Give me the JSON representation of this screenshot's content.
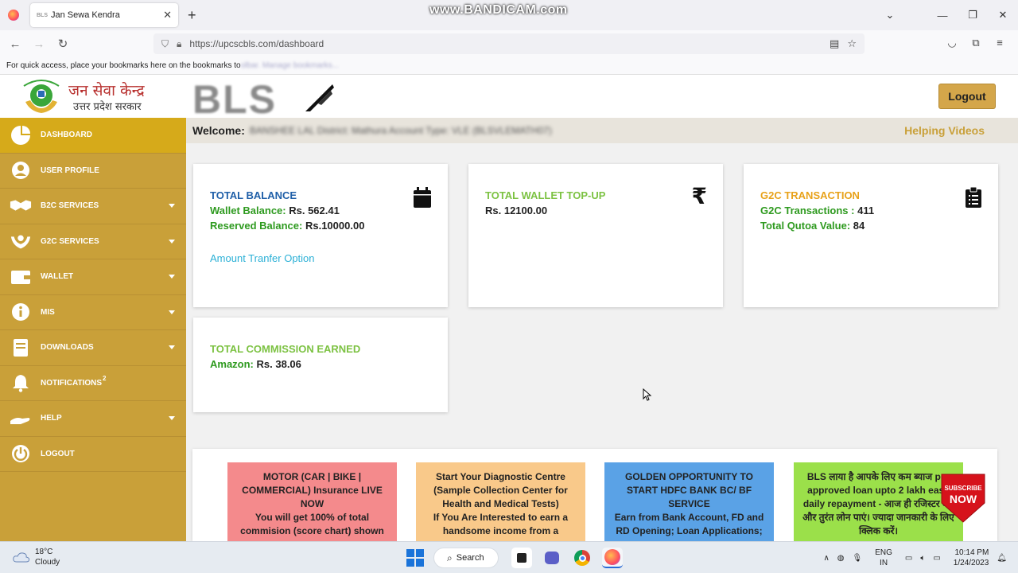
{
  "browser": {
    "tab_title": "Jan Sewa Kendra",
    "tab_favicon_text": "BLS",
    "url": "https://upcscbls.com/dashboard",
    "bookmarks_hint": "For quick access, place your bookmarks here on the bookmarks to",
    "bookmarks_hint_blurred": "olbar. Manage bookmarks...",
    "watermark": "www.BANDICAM.com"
  },
  "header": {
    "jsk_line1": "जन सेवा केन्द्र",
    "jsk_line2": "उत्तर प्रदेश सरकार",
    "bls_logo": "BLS",
    "logout_label": "Logout"
  },
  "sidebar": {
    "items": [
      {
        "label": "DASHBOARD",
        "icon": "pie-chart-icon",
        "active": true,
        "dropdown": false
      },
      {
        "label": "USER PROFILE",
        "icon": "user-icon",
        "active": false,
        "dropdown": false
      },
      {
        "label": "B2C SERVICES",
        "icon": "handshake-icon",
        "active": false,
        "dropdown": true
      },
      {
        "label": "G2C SERVICES",
        "icon": "hands-icon",
        "active": false,
        "dropdown": true
      },
      {
        "label": "WALLET",
        "icon": "wallet-icon",
        "active": false,
        "dropdown": true
      },
      {
        "label": "MIS",
        "icon": "info-icon",
        "active": false,
        "dropdown": true
      },
      {
        "label": "DOWNLOADS",
        "icon": "book-icon",
        "active": false,
        "dropdown": true
      },
      {
        "label": "NOTIFICATIONS",
        "icon": "bell-icon",
        "active": false,
        "dropdown": false,
        "badge": "2"
      },
      {
        "label": "HELP",
        "icon": "help-hand-icon",
        "active": false,
        "dropdown": true
      },
      {
        "label": "LOGOUT",
        "icon": "power-icon",
        "active": false,
        "dropdown": false
      }
    ]
  },
  "welcome": {
    "label": "Welcome:",
    "blurred_info": "BANSHEE LAL    District: Mathura    Account Type: VLE (BLSVLEMATH07)",
    "helping_videos": "Helping Videos"
  },
  "cards": {
    "balance": {
      "title": "TOTAL BALANCE",
      "wallet_label": "Wallet Balance:",
      "wallet_value": "Rs. 562.41",
      "reserved_label": "Reserved Balance:",
      "reserved_value": "Rs.10000.00",
      "link": "Amount Tranfer Option",
      "title_color": "#1f5fa8",
      "icon": "calendar-icon"
    },
    "topup": {
      "title": "TOTAL WALLET TOP-UP",
      "value": "Rs. 12100.00",
      "title_color": "#7cc242",
      "icon": "rupee-icon"
    },
    "g2c": {
      "title": "G2C TRANSACTION",
      "tx_label": "G2C Transactions :",
      "tx_value": "411",
      "quota_label": "Total Qutoa Value:",
      "quota_value": "84",
      "title_color": "#e8a21a",
      "icon": "clipboard-icon"
    },
    "commission": {
      "title": "TOTAL COMMISSION EARNED",
      "amazon_label": "Amazon:",
      "amazon_value": "Rs. 38.06",
      "title_color": "#7cc242"
    }
  },
  "promos": [
    {
      "text": "MOTOR (CAR | BIKE | COMMERCIAL) Insurance LIVE NOW\nYou will get 100% of total commision (score chart) shown",
      "bg": "#f48a8c"
    },
    {
      "text": "Start Your Diagnostic Centre (Sample Collection Center for Health and Medical Tests)\nIf You Are Interested to earn a handsome income from a",
      "bg": "#f9c98a"
    },
    {
      "text": "GOLDEN OPPORTUNITY TO START HDFC BANK BC/ BF SERVICE\nEarn from Bank Account, FD and RD Opening; Loan Applications;",
      "bg": "#5aa2e6"
    },
    {
      "text": "BLS लाया है आपके लिए कम ब्याज pre approved loan upto 2 lakh easy daily repayment - आज ही रजिस्टर करें और तुरंत लोन पाएं। ज्यादा जानकारी के लिए क्लिक करें।",
      "bg": "#9be04a"
    }
  ],
  "subscribe": {
    "line1": "SUBSCRIBE",
    "line2": "NOW"
  },
  "taskbar": {
    "temperature": "18°C",
    "condition": "Cloudy",
    "search_label": "Search",
    "lang_line1": "ENG",
    "lang_line2": "IN",
    "time": "10:14 PM",
    "date": "1/24/2023"
  }
}
